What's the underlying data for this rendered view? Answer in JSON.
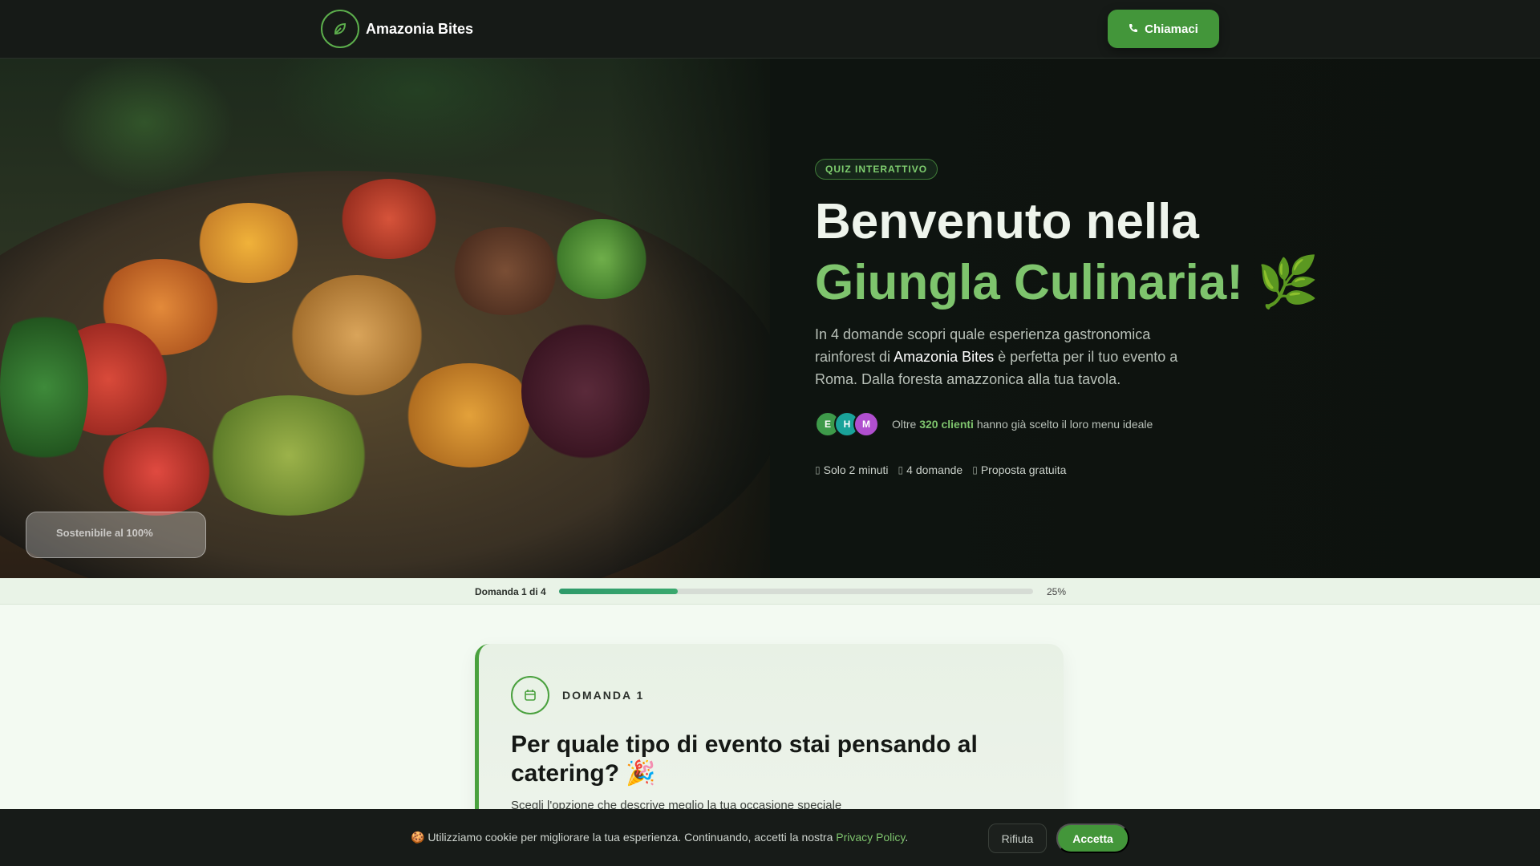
{
  "header": {
    "brand_name": "Amazonia Bites",
    "logo_icon": "leaf-icon",
    "call_label": "Chiamaci",
    "call_icon": "phone-icon"
  },
  "hero": {
    "image_badge": "Sostenibile al 100%",
    "tag": "QUIZ INTERATTIVO",
    "title_line1": "Benvenuto nella",
    "title_line2": "Giungla Culinaria! 🌿",
    "intro_before": "In 4 domande scopri quale esperienza gastronomica rainforest di ",
    "intro_brand": "Amazonia Bites",
    "intro_after": " è perfetta per il tuo evento a Roma. Dalla foresta amazzonica alla tua tavola.",
    "avatars": [
      {
        "letter": "E",
        "color": "#3e9a4a"
      },
      {
        "letter": "H",
        "color": "#1aa39a"
      },
      {
        "letter": "M",
        "color": "#b04fcf"
      }
    ],
    "social_prefix": "Oltre ",
    "social_count": "320 clienti",
    "social_suffix": " hanno già scelto il loro menu ideale",
    "features": [
      {
        "icon": "clock-icon",
        "label": "Solo 2 minuti"
      },
      {
        "icon": "list-icon",
        "label": "4 domande"
      },
      {
        "icon": "gift-icon",
        "label": "Proposta gratuita"
      }
    ]
  },
  "progress": {
    "label": "Domanda 1 di 4",
    "percent_text": "25%",
    "fraction": 0.25,
    "color": "#2e9a6a"
  },
  "question": {
    "icon": "calendar-icon",
    "label": "DOMANDA 1",
    "title": "Per quale tipo di evento stai pensando al catering? 🎉",
    "subtitle": "Scegli l'opzione che descrive meglio la tua occasione speciale"
  },
  "cookie": {
    "text": "🍪 Utilizziamo cookie per migliorare la tua esperienza. Continuando, accetti la nostra ",
    "link": "Privacy Policy",
    "link_after": ".",
    "reject_label": "Rifiuta",
    "accept_label": "Accetta"
  },
  "colors": {
    "accent": "#43963a",
    "accent_light": "#7ec46d",
    "dark_bg": "#161a17"
  }
}
